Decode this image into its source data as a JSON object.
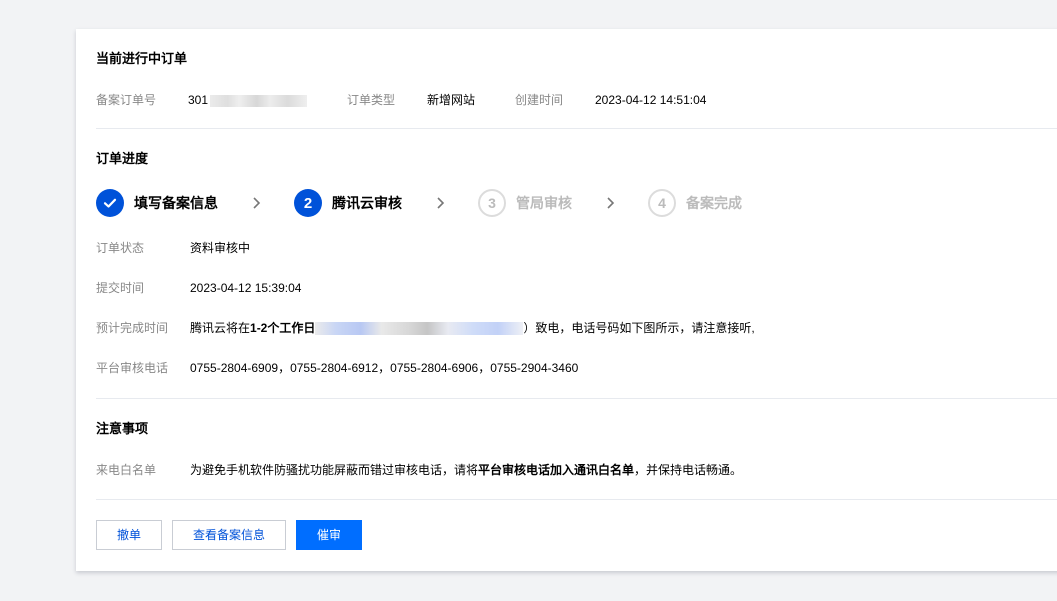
{
  "current_order": {
    "title": "当前进行中订单",
    "order_no_label": "备案订单号",
    "order_no_visible": "301",
    "order_type_label": "订单类型",
    "order_type_value": "新增网站",
    "created_label": "创建时间",
    "created_value": "2023-04-12 14:51:04"
  },
  "progress": {
    "title": "订单进度",
    "steps": [
      {
        "number": "",
        "label": "填写备案信息",
        "state": "done"
      },
      {
        "number": "2",
        "label": "腾讯云审核",
        "state": "active"
      },
      {
        "number": "3",
        "label": "管局审核",
        "state": "pending"
      },
      {
        "number": "4",
        "label": "备案完成",
        "state": "pending"
      }
    ],
    "status_label": "订单状态",
    "status_value": "资料审核中",
    "submit_label": "提交时间",
    "submit_value": "2023-04-12 15:39:04",
    "eta_label": "预计完成时间",
    "eta_prefix": "腾讯云将在",
    "eta_emphasis": "1-2个工作日",
    "eta_suffix": "）致电，电话号码如下图所示，请注意接听,",
    "phone_label": "平台审核电话",
    "phone_value": "0755-2804-6909，0755-2804-6912，0755-2804-6906，0755-2904-3460"
  },
  "notice": {
    "title": "注意事项",
    "whitelist_label": "来电白名单",
    "text_prefix": "为避免手机软件防骚扰功能屏蔽而错过审核电话，请将",
    "text_emphasis": "平台审核电话加入通讯白名单",
    "text_suffix": "，并保持电话畅通。"
  },
  "actions": {
    "withdraw": "撤单",
    "view_info": "查看备案信息",
    "urge": "催审"
  },
  "colors": {
    "primary": "#0052d9",
    "button_primary": "#006eff",
    "label": "#888888",
    "pending": "#bbbbbb"
  }
}
